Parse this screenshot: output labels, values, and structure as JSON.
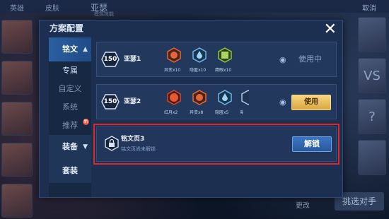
{
  "background": {
    "tabs": [
      "英雄",
      "皮肤"
    ],
    "hero_name": "亚瑟",
    "hero_subtitle": "模拟技能",
    "cancel_label": "取消",
    "change_label": "更改",
    "select_opponent_label": "挑选对手",
    "right_glyphs": [
      "VS",
      "?"
    ]
  },
  "modal": {
    "title": "方案配置",
    "close_glyph": "✕"
  },
  "sidebar": {
    "section_rune": "铭文",
    "items": [
      "专属",
      "自定义",
      "系统",
      "推荐"
    ],
    "recommend_badge": "新",
    "section_equipment": "装备",
    "section_set": "套装"
  },
  "rune_pages": [
    {
      "level": "150",
      "name": "亚瑟1",
      "gems": [
        {
          "label": "异变x10",
          "color": "#e4653b",
          "icon": "mutation-gem-icon"
        },
        {
          "label": "隐匿x10",
          "color": "#6fb6e8",
          "icon": "stealth-gem-icon"
        },
        {
          "label": "鹰眼x10",
          "color": "#8cc63f",
          "icon": "hawkeye-gem-icon"
        }
      ],
      "status": "使用中",
      "eye_icon": "view-eye-icon"
    },
    {
      "level": "150",
      "name": "亚瑟2",
      "gems": [
        {
          "label": "红月x2",
          "color": "#d8462c",
          "icon": "red-moon-gem-icon"
        },
        {
          "label": "异变x8",
          "color": "#e4653b",
          "icon": "mutation-gem-icon"
        },
        {
          "label": "隐匿x5",
          "color": "#6fb6e8",
          "icon": "stealth-gem-icon"
        },
        {
          "label": "兽",
          "color": "#a9c8e6",
          "icon": "beast-gem-icon"
        }
      ],
      "button": "使用",
      "eye_icon": "view-eye-icon"
    }
  ],
  "locked_page": {
    "title": "铭文页3",
    "subtitle": "铭文页尚未解锁",
    "button": "解锁"
  }
}
